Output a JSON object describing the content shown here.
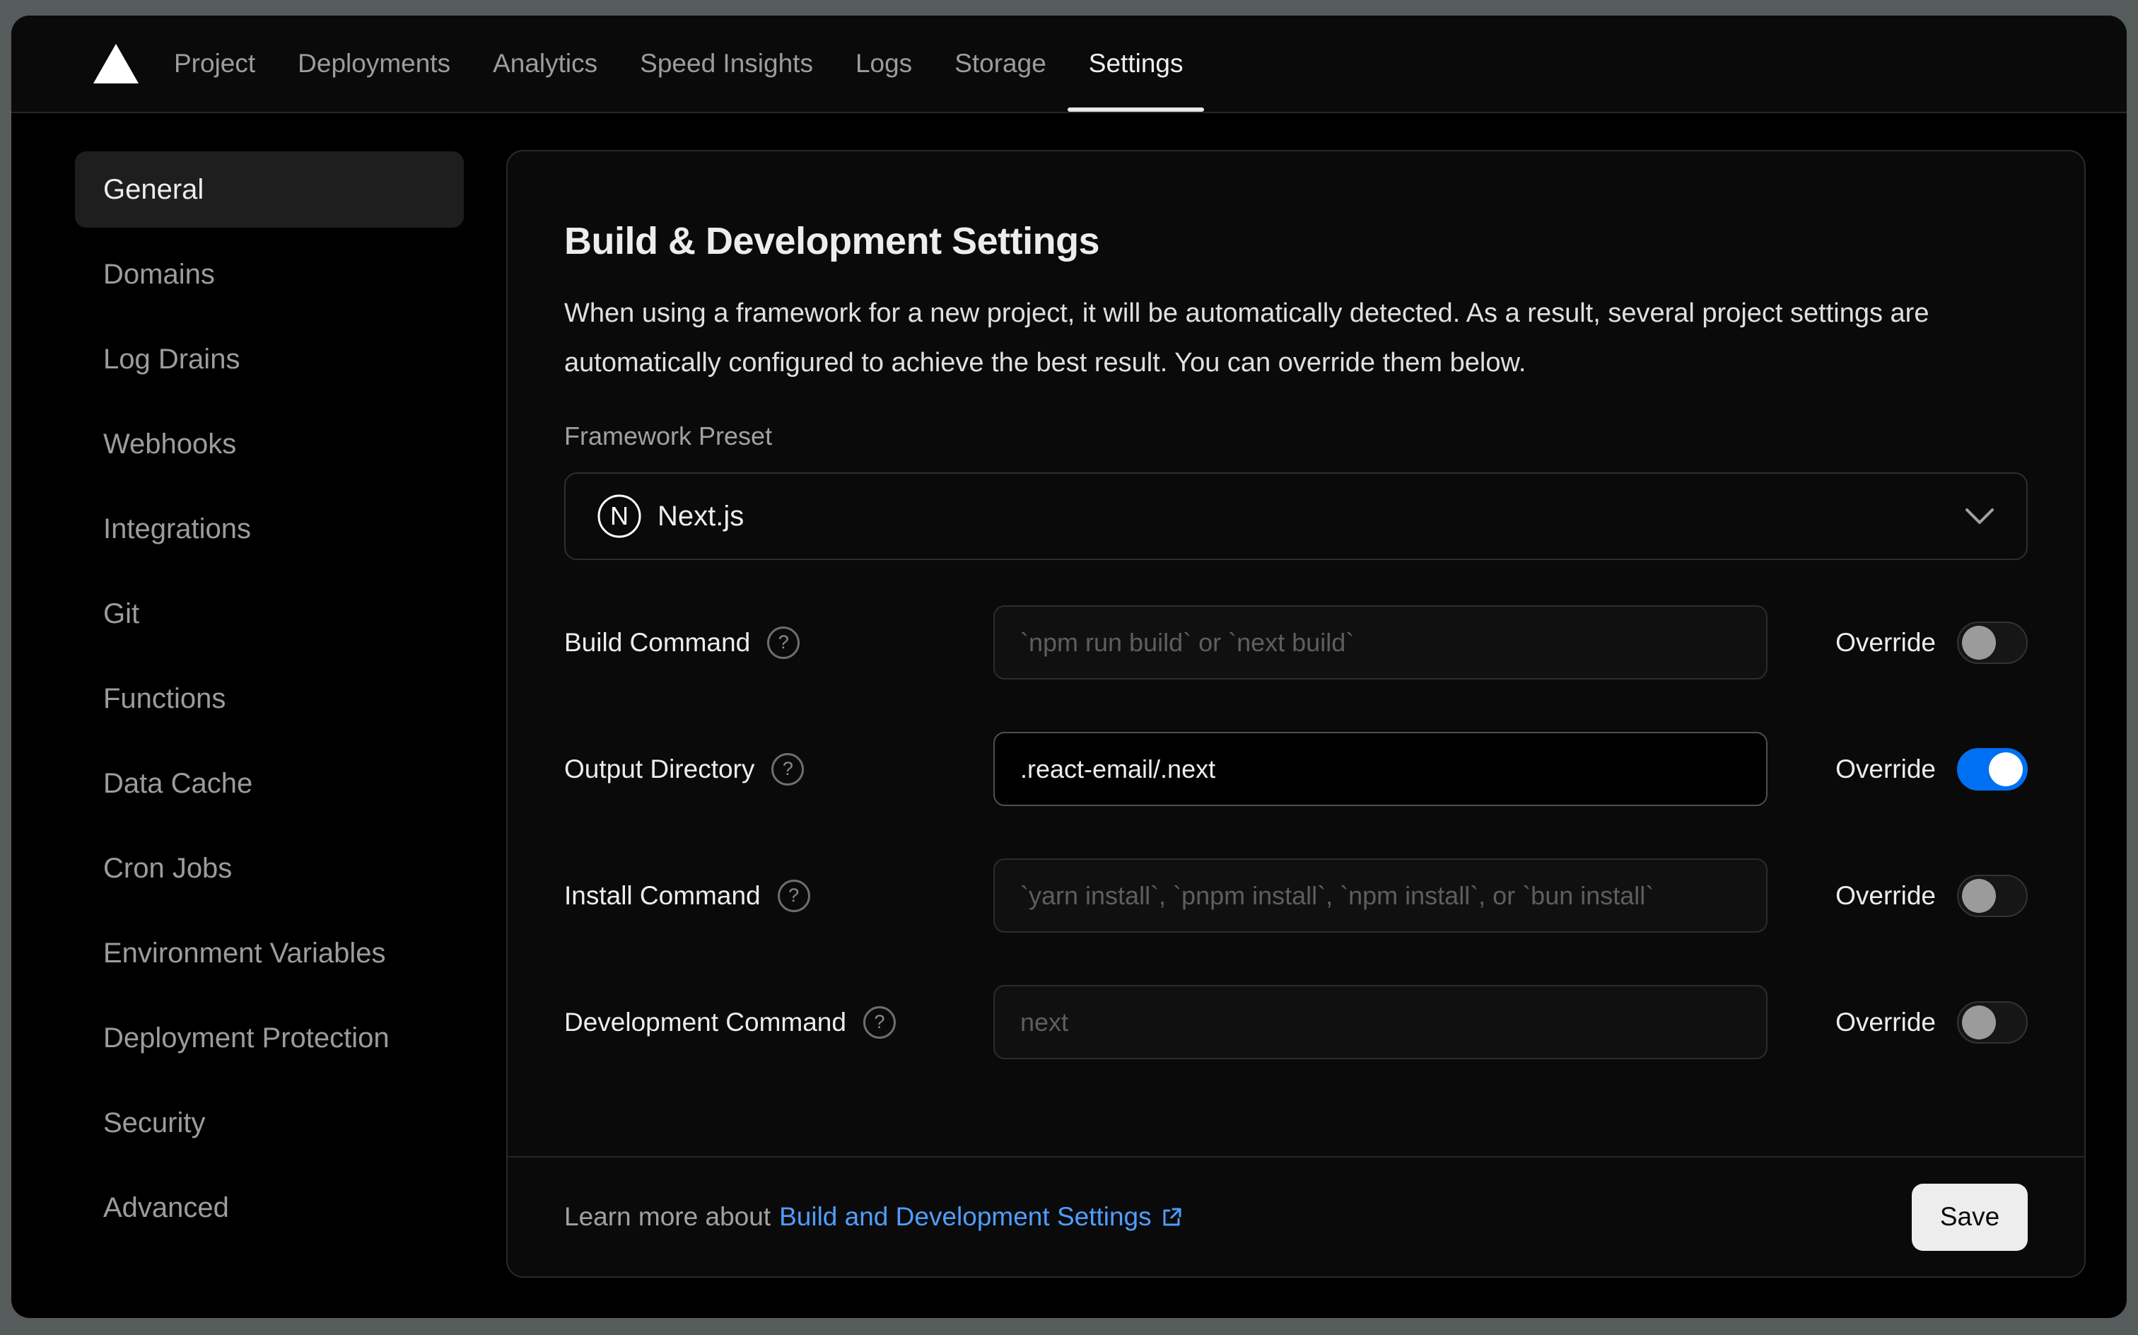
{
  "nav": {
    "items": [
      {
        "label": "Project",
        "active": false
      },
      {
        "label": "Deployments",
        "active": false
      },
      {
        "label": "Analytics",
        "active": false
      },
      {
        "label": "Speed Insights",
        "active": false
      },
      {
        "label": "Logs",
        "active": false
      },
      {
        "label": "Storage",
        "active": false
      },
      {
        "label": "Settings",
        "active": true
      }
    ]
  },
  "sidebar": {
    "items": [
      {
        "label": "General",
        "active": true
      },
      {
        "label": "Domains",
        "active": false
      },
      {
        "label": "Log Drains",
        "active": false
      },
      {
        "label": "Webhooks",
        "active": false
      },
      {
        "label": "Integrations",
        "active": false
      },
      {
        "label": "Git",
        "active": false
      },
      {
        "label": "Functions",
        "active": false
      },
      {
        "label": "Data Cache",
        "active": false
      },
      {
        "label": "Cron Jobs",
        "active": false
      },
      {
        "label": "Environment Variables",
        "active": false
      },
      {
        "label": "Deployment Protection",
        "active": false
      },
      {
        "label": "Security",
        "active": false
      },
      {
        "label": "Advanced",
        "active": false
      }
    ]
  },
  "panel": {
    "title": "Build & Development Settings",
    "description": "When using a framework for a new project, it will be automatically detected. As a result, several project settings are automatically configured to achieve the best result. You can override them below.",
    "framework": {
      "label": "Framework Preset",
      "selected": "Next.js",
      "icon": "nextjs-logo-icon"
    },
    "override_label": "Override",
    "rows": [
      {
        "label": "Build Command",
        "placeholder": "`npm run build` or `next build`",
        "value": "",
        "override": false
      },
      {
        "label": "Output Directory",
        "placeholder": "",
        "value": ".react-email/.next",
        "override": true
      },
      {
        "label": "Install Command",
        "placeholder": "`yarn install`, `pnpm install`, `npm install`, or `bun install`",
        "value": "",
        "override": false
      },
      {
        "label": "Development Command",
        "placeholder": "next",
        "value": "",
        "override": false
      }
    ],
    "footer": {
      "learn_more_prefix": "Learn more about",
      "link_text": "Build and Development Settings",
      "save_label": "Save"
    }
  },
  "colors": {
    "accent_link_blue": "#4e9eff",
    "toggle_on_blue": "#0070f3",
    "save_button_bg": "#ededed",
    "card_bg": "#0a0a0a",
    "page_frame_gray": "#565b5c",
    "active_item_bg": "#1e1e1e"
  }
}
